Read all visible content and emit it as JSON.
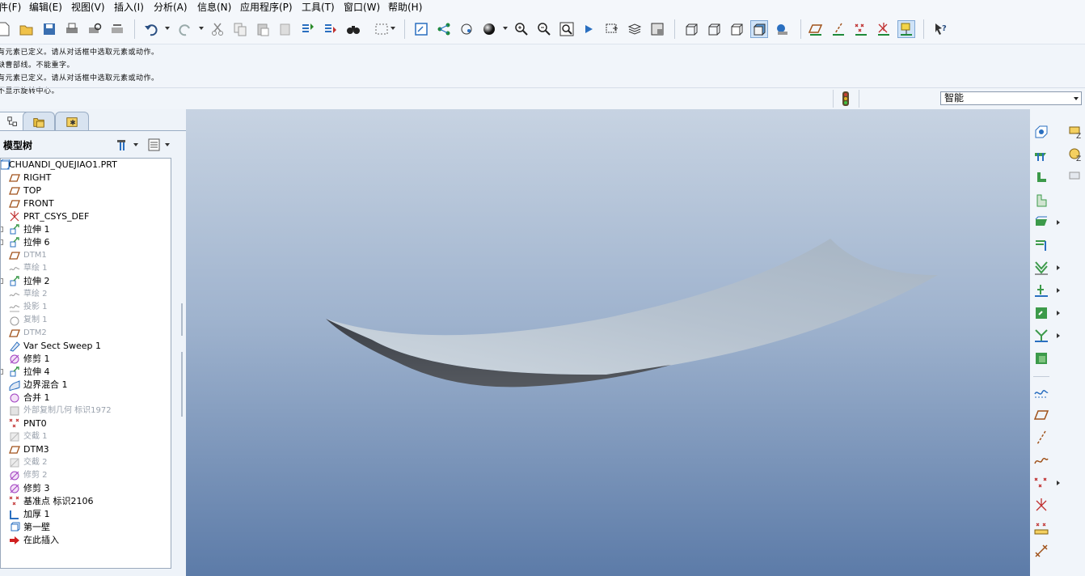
{
  "menu": [
    "件(F)",
    "编辑(E)",
    "视图(V)",
    "插入(I)",
    "分析(A)",
    "信息(N)",
    "应用程序(P)",
    "工具(T)",
    "窗口(W)",
    "帮助(H)"
  ],
  "messages": [
    "有元素已定义。请从对话框中选取元素或动作。",
    "缺曹部线。不能重字。",
    "有元素已定义。请从对话框中选取元素或动作。",
    "不显示旋转中心。"
  ],
  "filter": {
    "selected": "智能"
  },
  "panel": {
    "title": "模型树"
  },
  "tree": [
    {
      "label": "CHUANDI_QUEJIAO1.PRT",
      "icon": "part-icon",
      "dim": false
    },
    {
      "label": "RIGHT",
      "icon": "datum-plane-icon",
      "dim": false
    },
    {
      "label": "TOP",
      "icon": "datum-plane-icon",
      "dim": false
    },
    {
      "label": "FRONT",
      "icon": "datum-plane-icon",
      "dim": false
    },
    {
      "label": "PRT_CSYS_DEF",
      "icon": "csys-icon",
      "dim": false
    },
    {
      "label": "拉伸 1",
      "icon": "extrude-icon",
      "dim": false
    },
    {
      "label": "拉伸 6",
      "icon": "extrude-icon",
      "dim": false
    },
    {
      "label": "DTM1",
      "icon": "datum-plane-icon",
      "dim": true
    },
    {
      "label": "草绘 1",
      "icon": "sketch-icon",
      "dim": true
    },
    {
      "label": "拉伸 2",
      "icon": "extrude-icon",
      "dim": false
    },
    {
      "label": "草绘 2",
      "icon": "sketch-icon",
      "dim": true
    },
    {
      "label": "投影 1",
      "icon": "projection-icon",
      "dim": true
    },
    {
      "label": "复制 1",
      "icon": "copy-icon",
      "dim": true
    },
    {
      "label": "DTM2",
      "icon": "datum-plane-icon",
      "dim": true
    },
    {
      "label": "Var Sect Sweep 1",
      "icon": "sweep-icon",
      "dim": false
    },
    {
      "label": "修剪 1",
      "icon": "trim-icon",
      "dim": false
    },
    {
      "label": "拉伸 4",
      "icon": "extrude-icon",
      "dim": false
    },
    {
      "label": "边界混合 1",
      "icon": "boundary-blend-icon",
      "dim": false
    },
    {
      "label": "合并 1",
      "icon": "merge-icon",
      "dim": false
    },
    {
      "label": "外部复制几何 标识1972",
      "icon": "external-copy-icon",
      "dim": true
    },
    {
      "label": "PNT0",
      "icon": "datum-point-icon",
      "dim": false
    },
    {
      "label": "交截 1",
      "icon": "intersect-icon",
      "dim": true
    },
    {
      "label": "DTM3",
      "icon": "datum-plane-icon",
      "dim": false
    },
    {
      "label": "交截 2",
      "icon": "intersect-icon",
      "dim": true
    },
    {
      "label": "修剪 2",
      "icon": "trim-icon",
      "dim": true
    },
    {
      "label": "修剪 3",
      "icon": "trim-icon",
      "dim": false
    },
    {
      "label": "基准点 标识2106",
      "icon": "datum-point-icon",
      "dim": false
    },
    {
      "label": "加厚 1",
      "icon": "thicken-icon",
      "dim": false
    },
    {
      "label": "第一壁",
      "icon": "first-wall-icon",
      "dim": false
    },
    {
      "label": "在此插入",
      "icon": "insert-here-arrow-icon",
      "dim": false
    }
  ],
  "colors": {
    "viewport_top": "#c7d3e2",
    "viewport_bottom": "#5c7ba8",
    "surface_light": "#bcc8d4",
    "surface_dark": "#4a4f57",
    "datum_plane": "#a0521a"
  }
}
